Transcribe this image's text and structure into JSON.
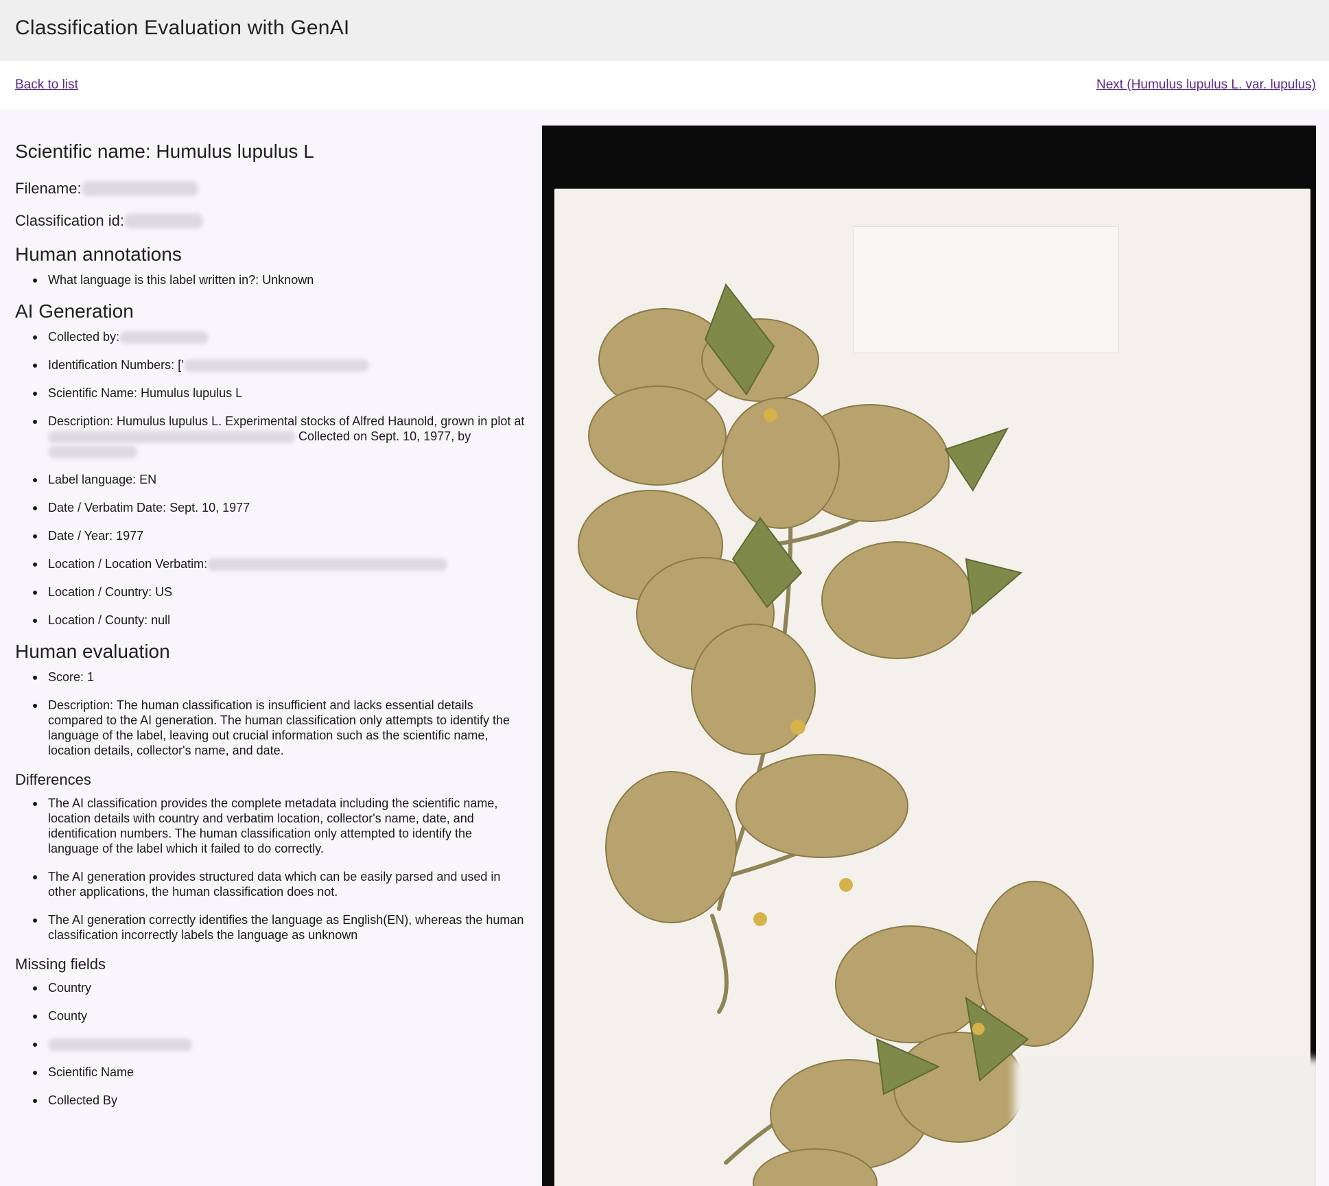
{
  "app": {
    "title": "Classification Evaluation with GenAI"
  },
  "nav": {
    "back_label": "Back to list",
    "next_label": "Next (Humulus lupulus L. var. lupulus)"
  },
  "record": {
    "scientific_name_heading": "Scientific name: Humulus lupulus L",
    "filename_label": "Filename:",
    "classification_id_label": "Classification id:"
  },
  "human_annotations": {
    "heading": "Human annotations",
    "items": [
      "What language is this label written in?: Unknown"
    ]
  },
  "ai_generation": {
    "heading": "AI Generation",
    "collected_by": "Collected by:",
    "identification_numbers": "Identification Numbers: ['",
    "scientific_name": "Scientific Name: Humulus lupulus L",
    "description_a": "Description: Humulus lupulus L. Experimental stocks of Alfred Haunold, grown in plot at",
    "description_b": "Collected on Sept. 10, 1977, by",
    "label_language": "Label language: EN",
    "verbatim_date": "Date / Verbatim Date: Sept. 10, 1977",
    "year": "Date / Year: 1977",
    "location_verbatim": "Location / Location Verbatim:",
    "country": "Location / Country: US",
    "county": "Location / County: null"
  },
  "human_evaluation": {
    "heading": "Human evaluation",
    "score": "Score: 1",
    "description": "Description: The human classification is insufficient and lacks essential details compared to the AI generation. The human classification only attempts to identify the language of the label, leaving out crucial information such as the scientific name, location details, collector's name, and date."
  },
  "differences": {
    "heading": "Differences",
    "items": [
      "The AI classification provides the complete metadata including the scientific name, location details with country and verbatim location, collector's name, date, and identification numbers. The human classification only attempted to identify the language of the label which it failed to do correctly.",
      "The AI generation provides structured data which can be easily parsed and used in other applications, the human classification does not.",
      "The AI generation correctly identifies the language as English(EN), whereas the human classification incorrectly labels the language as unknown"
    ]
  },
  "missing_fields": {
    "heading": "Missing fields",
    "items": [
      "Country",
      "County",
      "Scientific Name",
      "Collected By"
    ]
  },
  "colors": {
    "link": "#5b2a86",
    "header_bg": "#efefef",
    "page_bg": "#f8f6fb"
  }
}
